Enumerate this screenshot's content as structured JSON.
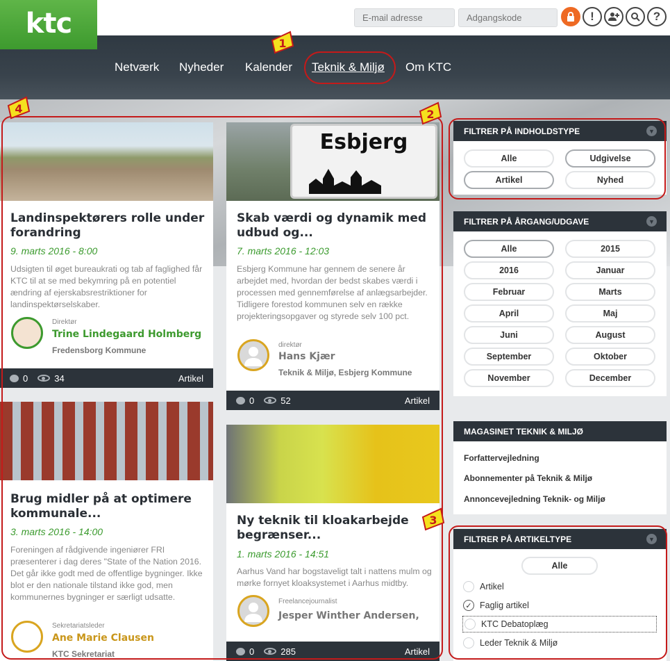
{
  "brand": {
    "logo": "ktc"
  },
  "login": {
    "email_placeholder": "E-mail adresse",
    "password_placeholder": "Adgangskode"
  },
  "header_icons": [
    "lock-icon",
    "alert-icon",
    "add-user-icon",
    "search-icon",
    "help-icon"
  ],
  "nav": {
    "items": [
      "Netværk",
      "Nyheder",
      "Kalender",
      "Teknik & Miljø",
      "Om KTC"
    ],
    "active": "Teknik & Miljø"
  },
  "annotations": [
    "1",
    "2",
    "3",
    "4"
  ],
  "articles": [
    {
      "title": "Landinspektørers rolle under forandring",
      "date": "9. marts 2016 - 8:00",
      "excerpt": "Udsigten til øget bureaukrati og tab af faglighed får KTC til at se med bekymring på en potentiel ændring af ejerskabsrestriktioner for landinspektørselskaber.",
      "author_role": "Direktør",
      "author_name": "Trine Lindegaard Holmberg",
      "author_org": "Fredensborg Kommune",
      "comments": "0",
      "views": "34",
      "type": "Artikel"
    },
    {
      "title": "Skab værdi og dynamik med udbud og...",
      "date": "7. marts 2016 - 12:03",
      "excerpt": "Esbjerg Kommune har gennem de senere år arbejdet med, hvordan der bedst skabes værdi i processen med gennemførelse af anlægsarbejder. Tidligere forestod kommunen selv en række projekteringsopgaver og styrede selv 100 pct.",
      "author_role": "direktør",
      "author_name": "Hans Kjær",
      "author_org": "Teknik & Miljø, Esbjerg Kommune",
      "comments": "0",
      "views": "52",
      "type": "Artikel",
      "image_sign": "Esbjerg"
    },
    {
      "title": "Brug midler på at optimere kommunale...",
      "date": "3. marts 2016 - 14:00",
      "excerpt": "Foreningen af rådgivende ingeniører FRI præsenterer i dag deres \"State of the Nation 2016. Det går ikke godt med de offentlige bygninger. Ikke blot er den nationale tilstand ikke god, men kommunernes bygninger er særligt udsatte.",
      "author_role": "Sekretariatsleder",
      "author_name": "Ane Marie Clausen",
      "author_org": "KTC Sekretariat"
    },
    {
      "title": "Ny teknik til kloakarbejde begrænser...",
      "date": "1. marts 2016 - 14:51",
      "excerpt": "Aarhus Vand har bogstaveligt talt i nattens mulm og mørke fornyet kloaksystemet i Aarhus midtby.",
      "author_role": "Freelancejournalist",
      "author_name": "Jesper Winther Andersen,",
      "comments": "0",
      "views": "285",
      "type": "Artikel"
    }
  ],
  "filters": {
    "content_type": {
      "title": "FILTRER PÅ INDHOLDSTYPE",
      "options": [
        "Alle",
        "Udgivelse",
        "Artikel",
        "Nyhed"
      ]
    },
    "year": {
      "title": "FILTRER PÅ ÅRGANG/UDGAVE",
      "options": [
        "Alle",
        "2015",
        "2016",
        "Januar",
        "Februar",
        "Marts",
        "April",
        "Maj",
        "Juni",
        "August",
        "September",
        "Oktober",
        "November",
        "December"
      ]
    },
    "article_type": {
      "title": "FILTRER PÅ ARTIKELTYPE",
      "all": "Alle",
      "options": [
        "Artikel",
        "Faglig artikel",
        "KTC Debatoplæg",
        "Leder Teknik & Miljø"
      ]
    }
  },
  "magazine": {
    "title": "MAGASINET TEKNIK & MILJØ",
    "links": [
      "Forfattervejledning",
      "Abonnementer på Teknik & Miljø",
      "Annoncevejledning Teknik- og Miljø"
    ]
  },
  "colors": {
    "brand_green": "#3d9a2e",
    "dark": "#2c333a",
    "accent_orange": "#ee6a24",
    "annotation_red": "#c41a1a",
    "annotation_yellow": "#f5e11e"
  }
}
